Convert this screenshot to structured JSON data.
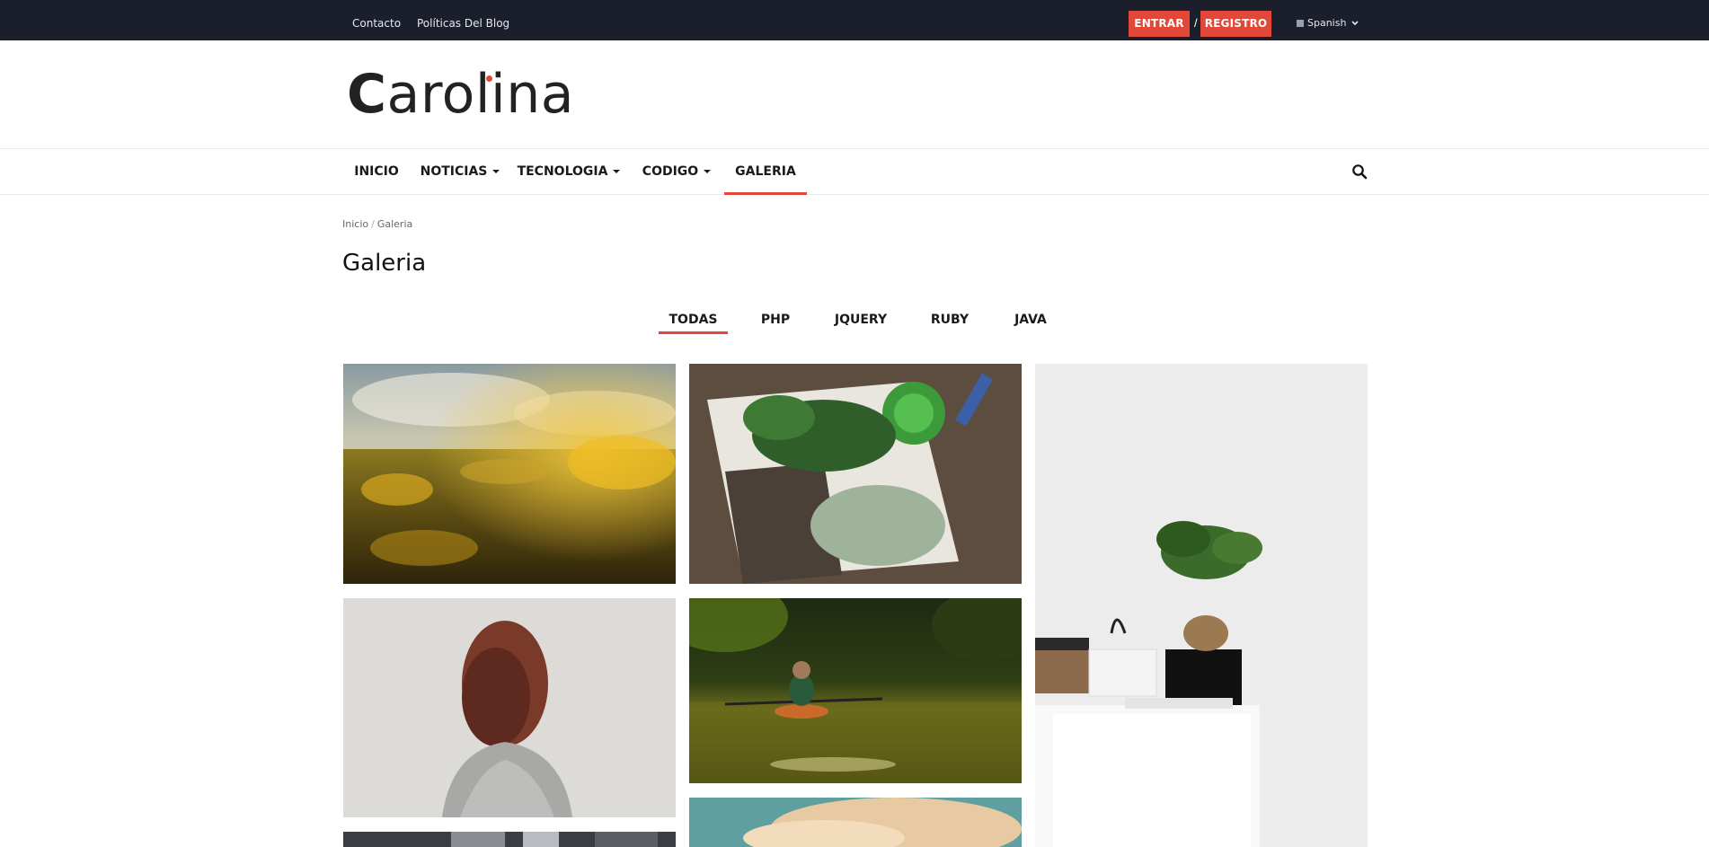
{
  "topbar": {
    "links": [
      "Contacto",
      "Políticas Del Blog"
    ],
    "login_label": "ENTRAR",
    "separator": "/",
    "register_label": "REGISTRO",
    "language": "Spanish"
  },
  "logo": {
    "first_letter": "C",
    "rest": "arolina"
  },
  "nav": {
    "items": [
      {
        "label": "INICIO",
        "has_dropdown": false,
        "active": false
      },
      {
        "label": "NOTICIAS",
        "has_dropdown": true,
        "active": false
      },
      {
        "label": "TECNOLOGIA",
        "has_dropdown": true,
        "active": false
      },
      {
        "label": "CODIGO",
        "has_dropdown": true,
        "active": false
      },
      {
        "label": "GALERIA",
        "has_dropdown": false,
        "active": true
      }
    ],
    "search_icon": "search-icon"
  },
  "breadcrumb": {
    "home": "Inicio",
    "separator": "/",
    "current": "Galeria"
  },
  "page": {
    "title": "Galeria"
  },
  "filters": {
    "tabs": [
      "TODAS",
      "PHP",
      "JQUERY",
      "RUBY",
      "JAVA"
    ],
    "active": "TODAS"
  },
  "gallery": {
    "photos": [
      "yellow-flower-field",
      "potted-plants-on-wood",
      "bonsai-on-white-desk",
      "woman-with-red-hair",
      "girl-in-kayak-on-river",
      "sky-with-clouds",
      "city-buildings"
    ]
  },
  "colors": {
    "accent": "#e24839",
    "topbar": "#1b1f2b"
  }
}
